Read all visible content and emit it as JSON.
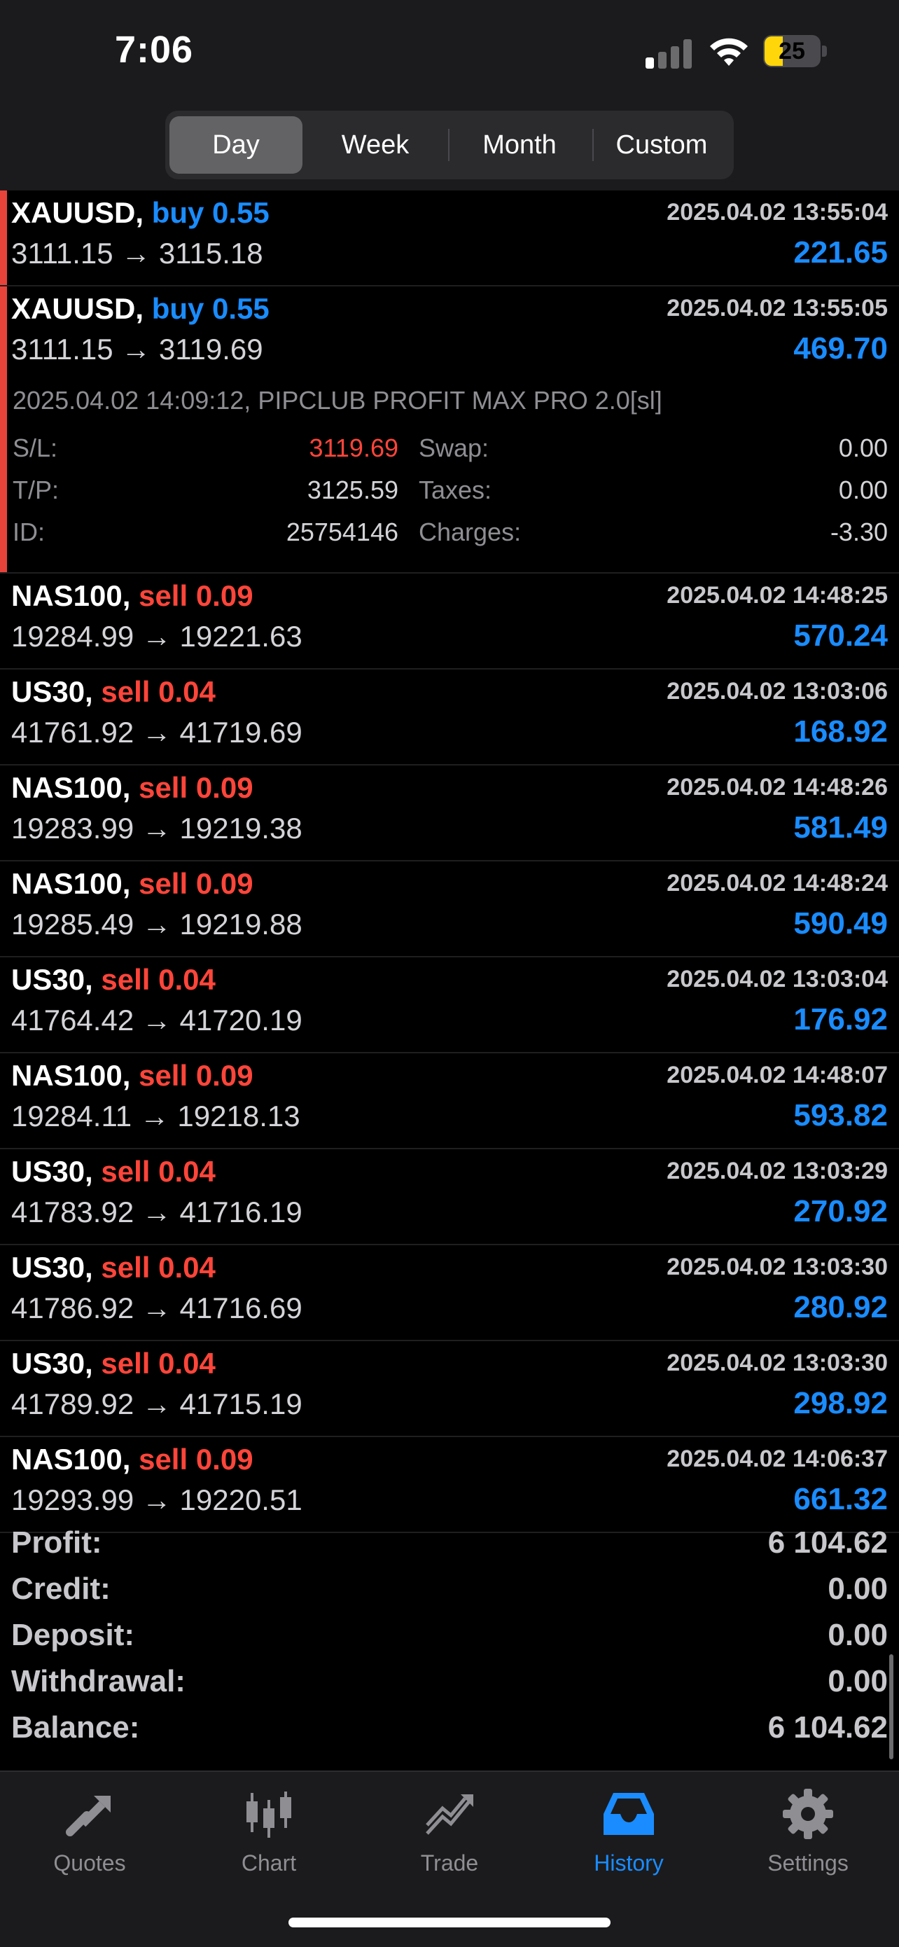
{
  "status_bar": {
    "time": "7:06",
    "battery": "25"
  },
  "period_tabs": [
    {
      "label": "Day",
      "active": true
    },
    {
      "label": "Week",
      "active": false
    },
    {
      "label": "Month",
      "active": false
    },
    {
      "label": "Custom",
      "active": false
    }
  ],
  "trades": [
    {
      "symbol": "XAUUSD,",
      "side": "buy 0.55",
      "side_type": "buy",
      "date": "2025.04.02 13:55:04",
      "prices": "3111.15 → 3115.18",
      "profit": "221.65",
      "accent": true
    },
    {
      "symbol": "XAUUSD,",
      "side": "buy 0.55",
      "side_type": "buy",
      "date": "2025.04.02 13:55:05",
      "prices": "3111.15 → 3119.69",
      "profit": "469.70",
      "accent": true
    },
    {
      "symbol": "NAS100,",
      "side": "sell 0.09",
      "side_type": "sell",
      "date": "2025.04.02 14:48:25",
      "prices": "19284.99 → 19221.63",
      "profit": "570.24",
      "accent": false
    },
    {
      "symbol": "US30,",
      "side": "sell 0.04",
      "side_type": "sell",
      "date": "2025.04.02 13:03:06",
      "prices": "41761.92 → 41719.69",
      "profit": "168.92",
      "accent": false
    },
    {
      "symbol": "NAS100,",
      "side": "sell 0.09",
      "side_type": "sell",
      "date": "2025.04.02 14:48:26",
      "prices": "19283.99 → 19219.38",
      "profit": "581.49",
      "accent": false
    },
    {
      "symbol": "NAS100,",
      "side": "sell 0.09",
      "side_type": "sell",
      "date": "2025.04.02 14:48:24",
      "prices": "19285.49 → 19219.88",
      "profit": "590.49",
      "accent": false
    },
    {
      "symbol": "US30,",
      "side": "sell 0.04",
      "side_type": "sell",
      "date": "2025.04.02 13:03:04",
      "prices": "41764.42 → 41720.19",
      "profit": "176.92",
      "accent": false
    },
    {
      "symbol": "NAS100,",
      "side": "sell 0.09",
      "side_type": "sell",
      "date": "2025.04.02 14:48:07",
      "prices": "19284.11 → 19218.13",
      "profit": "593.82",
      "accent": false
    },
    {
      "symbol": "US30,",
      "side": "sell 0.04",
      "side_type": "sell",
      "date": "2025.04.02 13:03:29",
      "prices": "41783.92 → 41716.19",
      "profit": "270.92",
      "accent": false
    },
    {
      "symbol": "US30,",
      "side": "sell 0.04",
      "side_type": "sell",
      "date": "2025.04.02 13:03:30",
      "prices": "41786.92 → 41716.69",
      "profit": "280.92",
      "accent": false
    },
    {
      "symbol": "US30,",
      "side": "sell 0.04",
      "side_type": "sell",
      "date": "2025.04.02 13:03:30",
      "prices": "41789.92 → 41715.19",
      "profit": "298.92",
      "accent": false
    },
    {
      "symbol": "NAS100,",
      "side": "sell 0.09",
      "side_type": "sell",
      "date": "2025.04.02 14:06:37",
      "prices": "19293.99 → 19220.51",
      "profit": "661.32",
      "accent": false
    }
  ],
  "detail": {
    "comment": "2025.04.02 14:09:12, PIPCLUB PROFIT MAX PRO 2.0[sl]",
    "sl_label": "S/L:",
    "sl_value": "3119.69",
    "tp_label": "T/P:",
    "tp_value": "3125.59",
    "id_label": "ID:",
    "id_value": "25754146",
    "swap_label": "Swap:",
    "swap_value": "0.00",
    "taxes_label": "Taxes:",
    "taxes_value": "0.00",
    "charges_label": "Charges:",
    "charges_value": "-3.30"
  },
  "summary": [
    {
      "label": "Profit:",
      "value": "6 104.62"
    },
    {
      "label": "Credit:",
      "value": "0.00"
    },
    {
      "label": "Deposit:",
      "value": "0.00"
    },
    {
      "label": "Withdrawal:",
      "value": "0.00"
    },
    {
      "label": "Balance:",
      "value": "6 104.62"
    }
  ],
  "tabs": [
    {
      "label": "Quotes",
      "icon": "quotes-icon",
      "active": false
    },
    {
      "label": "Chart",
      "icon": "candlestick-icon",
      "active": false
    },
    {
      "label": "Trade",
      "icon": "trade-trend-icon",
      "active": false
    },
    {
      "label": "History",
      "icon": "history-inbox-icon",
      "active": true
    },
    {
      "label": "Settings",
      "icon": "gear-icon",
      "active": false
    }
  ],
  "colors": {
    "buy": "#1a8cff",
    "sell": "#ff453a",
    "accent": "#e8433b",
    "active_tab": "#1a8cff"
  }
}
